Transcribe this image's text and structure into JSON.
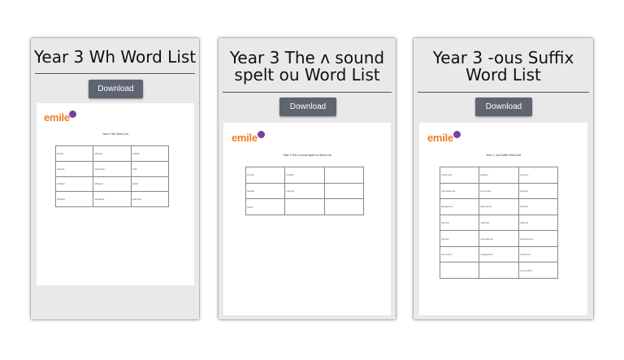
{
  "cards": [
    {
      "title_lines": [
        "Year 3 Wh Word List"
      ],
      "download_label": "Download",
      "logo": "emile",
      "doc_title": "Year 3 Wh Word List",
      "words": [
        [
          "wheat",
          "whisker",
          "whistle"
        ],
        [
          "wheels",
          "whenever",
          "whip"
        ],
        [
          "whisker",
          "whisper",
          "whisk"
        ],
        [
          "whacks",
          "whatever",
          "whopper"
        ]
      ]
    },
    {
      "title_lines": [
        "Year 3 The ʌ sound",
        "spelt ou Word List"
      ],
      "download_label": "Download",
      "logo": "emile",
      "doc_title": "Year 3 The ʌ sound spelt ou Word List",
      "words": [
        [
          "young",
          "trouble",
          ""
        ],
        [
          "double",
          "country",
          ""
        ],
        [
          "touch",
          "",
          ""
        ]
      ]
    },
    {
      "title_lines": [
        "Year 3 -ous Suffix",
        "Word List"
      ],
      "download_label": "Download",
      "logo": "emile",
      "doc_title": "Year 3 -ous Suffix Word List",
      "words": [
        [
          "poisonous",
          "jealous",
          "nervous"
        ],
        [
          "mountainous",
          "humorous",
          "glorious"
        ],
        [
          "dangerous",
          "glamorous",
          "obvious"
        ],
        [
          "famous",
          "vigorous",
          "hideous"
        ],
        [
          "various",
          "courageous",
          "spontaneous"
        ],
        [
          "enormous",
          "outrageous",
          "courteous"
        ],
        [
          "",
          "",
          "tremendous"
        ]
      ]
    }
  ]
}
